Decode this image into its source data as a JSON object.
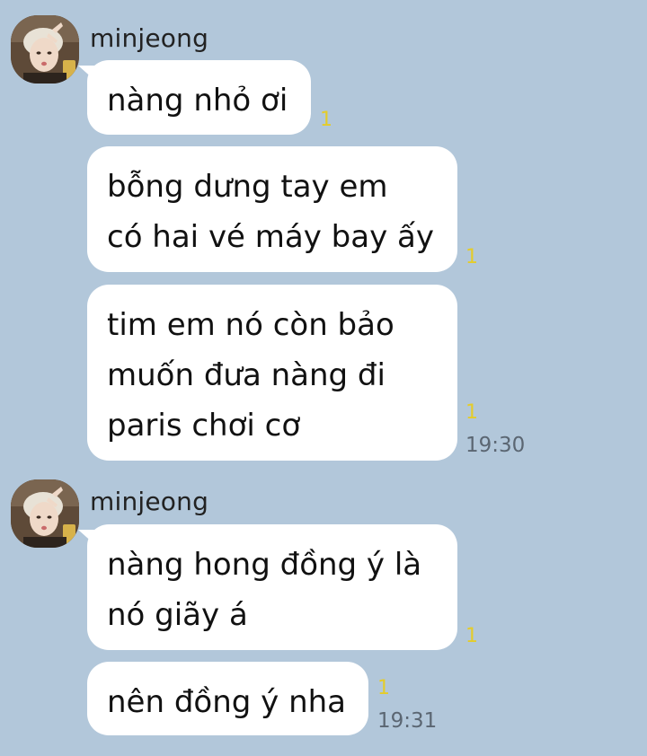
{
  "groups": [
    {
      "sender": "minjeong",
      "avatar_icon": "profile-photo",
      "messages": [
        {
          "text": "nàng nhỏ ơi",
          "unread": "1"
        },
        {
          "text": "bỗng dưng tay em\ncó hai vé máy bay ấy",
          "unread": "1"
        },
        {
          "text": "tim em nó còn bảo\nmuốn đưa nàng đi\nparis chơi cơ",
          "unread": "1",
          "time": "19:30"
        }
      ]
    },
    {
      "sender": "minjeong",
      "avatar_icon": "profile-photo",
      "messages": [
        {
          "text": "nàng hong đồng ý là\nnó giãy á",
          "unread": "1"
        },
        {
          "text": "nên đồng ý nha",
          "unread": "1",
          "time": "19:31"
        }
      ]
    }
  ],
  "colors": {
    "background": "#b2c7da",
    "bubble": "#ffffff",
    "unread": "#e4cc2a",
    "time": "#5b6672"
  }
}
